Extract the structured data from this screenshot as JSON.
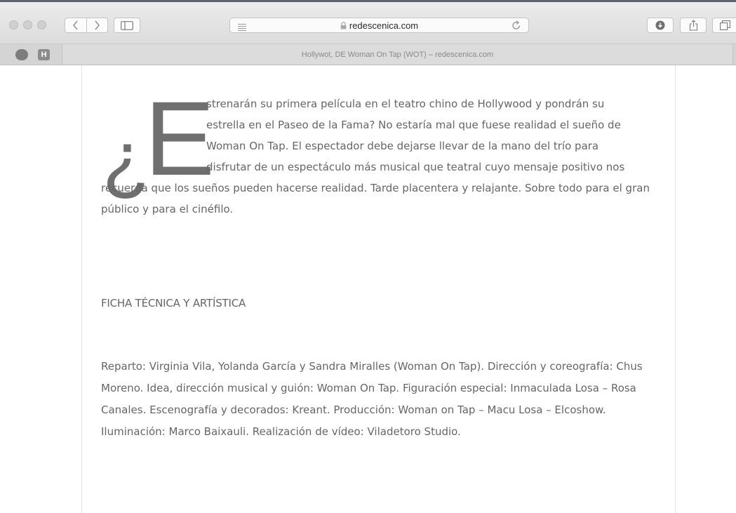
{
  "browser": {
    "url": "redescenica.com",
    "tab_title": "Hollywot, DE Woman On Tap (WOT) – redescenica.com",
    "favorites": [
      "pill-icon",
      "H"
    ]
  },
  "article": {
    "dropcap_q": "¿",
    "dropcap_e": "E",
    "intro_lines": [
      "strenarán su primera película en el teatro chino de Hollywood y pondrán su",
      "estrella en el Paseo de la Fama? No estaría mal que fuese realidad el sueño de",
      "Woman On Tap. El espectador debe dejarse llevar de la mano del trío para",
      "disfrutar de un espectáculo más musical que teatral cuyo mensaje positivo nos"
    ],
    "intro_rest": "recuerda que los sueños pueden hacerse realidad. Tarde placentera y  relajante. Sobre todo para el gran público y para el cinéfilo.",
    "section_title": "FICHA TÉCNICA Y ARTÍSTICA",
    "credits": "Reparto: Virginia Vila, Yolanda García y Sandra Miralles (Woman On Tap). Dirección y coreografía: Chus Moreno. Idea, dirección musical y guión: Woman On Tap. Figuración especial: Inmaculada Losa – Rosa Canales. Escenografía y decorados: Kreant. Producción: Woman on Tap – Macu Losa – Elcoshow. Iluminación: Marco Baixauli. Realización de vídeo: Viladetoro Studio."
  }
}
